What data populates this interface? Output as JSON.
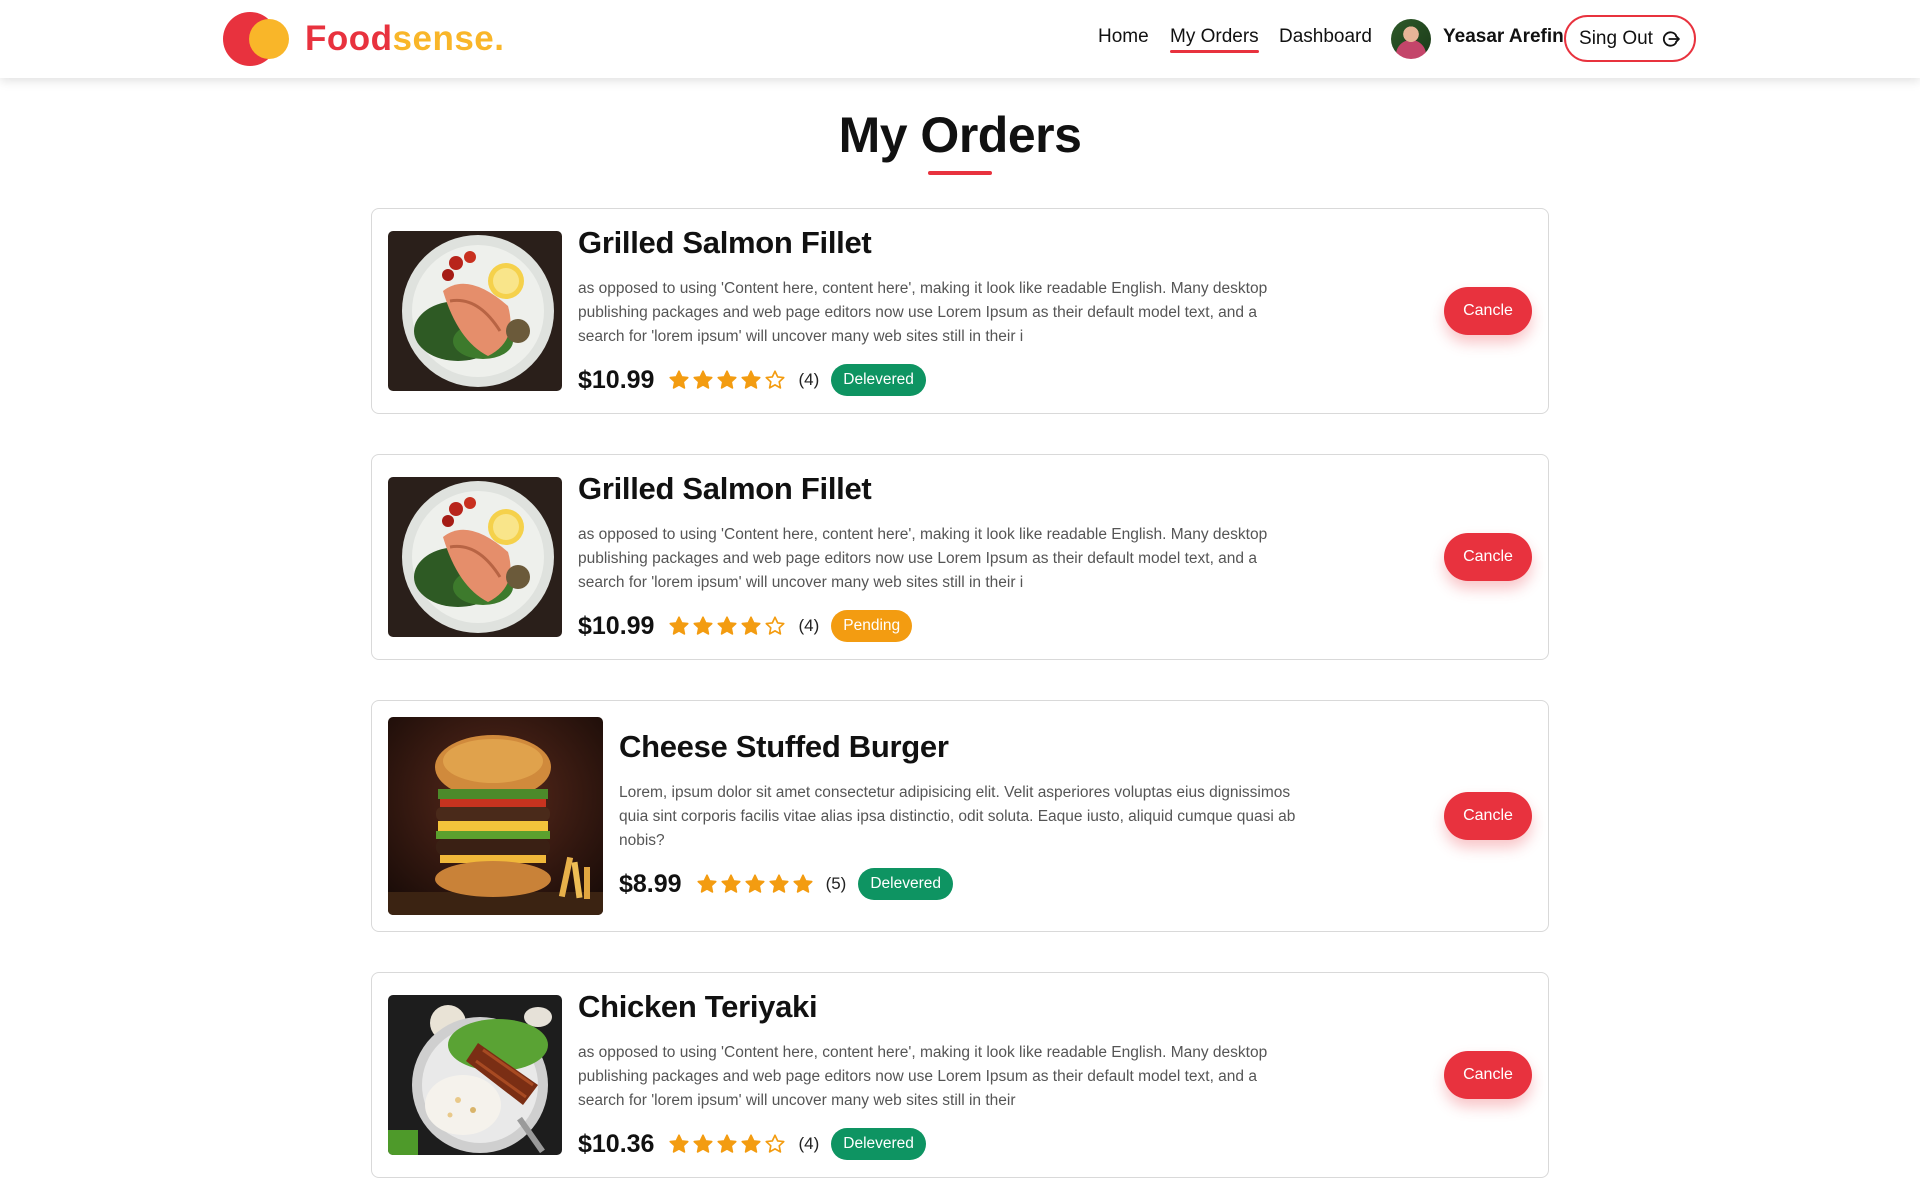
{
  "brand": {
    "name_part1": "Food",
    "name_part2": "sense."
  },
  "nav": {
    "home": "Home",
    "my_orders": "My Orders",
    "dashboard": "Dashboard",
    "user_name": "Yeasar Arefin",
    "signout": "Sing Out"
  },
  "page": {
    "title": "My Orders"
  },
  "cancel_label": "Cancle",
  "orders": [
    {
      "title": "Grilled Salmon Fillet",
      "description": "as opposed to using 'Content here, content here', making it look like readable English. Many desktop publishing packages and web page editors now use Lorem Ipsum as their default model text, and a search for 'lorem ipsum' will uncover many web sites still in their i",
      "price": "$10.99",
      "rating": 4,
      "rating_count": "(4)",
      "status": "Delevered",
      "image": "grilled-salmon-image"
    },
    {
      "title": "Grilled Salmon Fillet",
      "description": "as opposed to using 'Content here, content here', making it look like readable English. Many desktop publishing packages and web page editors now use Lorem Ipsum as their default model text, and a search for 'lorem ipsum' will uncover many web sites still in their i",
      "price": "$10.99",
      "rating": 4,
      "rating_count": "(4)",
      "status": "Pending",
      "image": "grilled-salmon-image"
    },
    {
      "title": "Cheese Stuffed Burger",
      "description": "Lorem, ipsum dolor sit amet consectetur adipisicing elit. Velit asperiores voluptas eius dignissimos quia sint corporis facilis vitae alias ipsa distinctio, odit soluta. Eaque iusto, aliquid cumque quasi ab nobis?",
      "price": "$8.99",
      "rating": 5,
      "rating_count": "(5)",
      "status": "Delevered",
      "image": "burger-image"
    },
    {
      "title": "Chicken Teriyaki",
      "description": "as opposed to using 'Content here, content here', making it look like readable English. Many desktop publishing packages and web page editors now use Lorem Ipsum as their default model text, and a search for 'lorem ipsum' will uncover many web sites still in their",
      "price": "$10.36",
      "rating": 4,
      "rating_count": "(4)",
      "status": "Delevered",
      "image": "chicken-teriyaki-image"
    }
  ],
  "colors": {
    "brand_red": "#e8323e",
    "brand_yellow": "#f9b629",
    "delivered_green": "#0e9462",
    "pending_orange": "#f39c11",
    "star": "#f39c11"
  }
}
